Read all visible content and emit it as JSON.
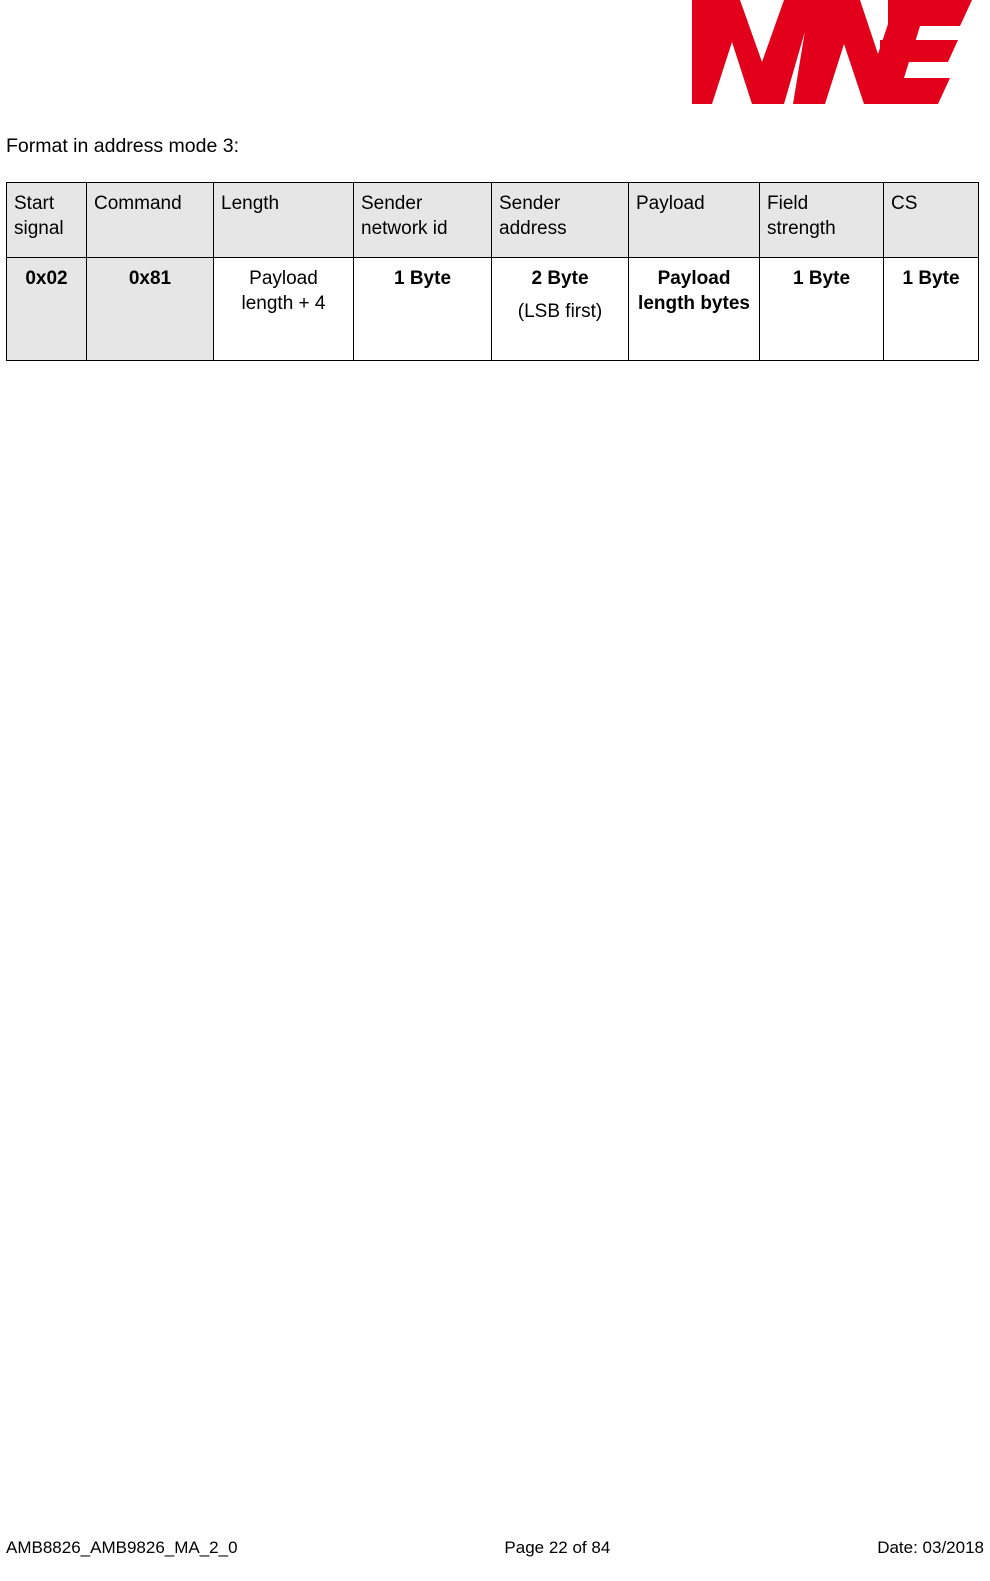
{
  "logo": {
    "name": "we-wurth-elektronik-logo",
    "brand_color": "#e3001b",
    "alt_text": "WE"
  },
  "intro": {
    "text": "Format in address mode 3:"
  },
  "table": {
    "headers": [
      "Start signal",
      "Command",
      "Length",
      "Sender network id",
      "Sender address",
      "Payload",
      "Field strength",
      "CS"
    ],
    "values": [
      "0x02",
      "0x81",
      "Payload length + 4",
      "1 Byte",
      "2 Byte",
      "Payload length bytes",
      "1 Byte",
      "1 Byte"
    ],
    "sender_address_note": "(LSB first)",
    "header_bg": "#e6e6e6",
    "shaded_bg": "#e6e6e6"
  },
  "footer": {
    "left": "AMB8826_AMB9826_MA_2_0",
    "center": "Page 22 of 84",
    "right": "Date: 03/2018"
  }
}
